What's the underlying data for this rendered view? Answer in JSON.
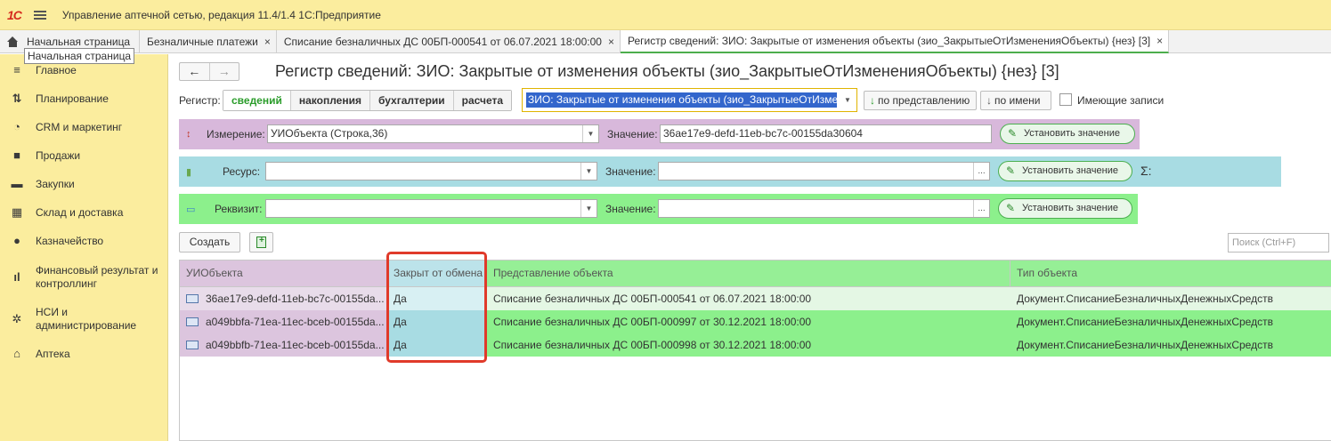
{
  "app": {
    "logo": "1С",
    "title": "Управление аптечной сетью, редакция 11.4/1.4 1С:Предприятие"
  },
  "tabs": [
    {
      "label": "Начальная страница"
    },
    {
      "label": "Безналичные платежи",
      "close": "×"
    },
    {
      "label": "Списание безналичных ДС 00БП-000541 от 06.07.2021 18:00:00",
      "close": "×"
    },
    {
      "label": "Регистр сведений: ЗИО: Закрытые от изменения объекты (зио_ЗакрытыеОтИзмененияОбъекты) {нез} [3]",
      "close": "×"
    }
  ],
  "tooltip": "Начальная страница",
  "sidebar": {
    "items": [
      {
        "label": "Главное",
        "icon": "menu-icon"
      },
      {
        "label": "Планирование",
        "icon": "planning-icon"
      },
      {
        "label": "CRM и маркетинг",
        "icon": "crm-icon"
      },
      {
        "label": "Продажи",
        "icon": "bag-icon"
      },
      {
        "label": "Закупки",
        "icon": "cart-icon"
      },
      {
        "label": "Склад и доставка",
        "icon": "warehouse-icon"
      },
      {
        "label": "Казначейство",
        "icon": "treasury-icon"
      },
      {
        "label": "Финансовый результат и контроллинг",
        "icon": "chart-icon"
      },
      {
        "label": "НСИ и администрирование",
        "icon": "gear-icon"
      },
      {
        "label": "Аптека",
        "icon": "pharmacy-icon"
      }
    ]
  },
  "form": {
    "back": "←",
    "forward": "→",
    "title": "Регистр сведений: ЗИО: Закрытые от изменения объекты (зио_ЗакрытыеОтИзмененияОбъекты) {нез} [3]",
    "register_label": "Регистр:",
    "register_types": [
      "сведений",
      "накопления",
      "бухгалтерии",
      "расчета"
    ],
    "register_value": "ЗИО: Закрытые от изменения объекты (зио_ЗакрытыеОтИзмене",
    "sort_repr": "по представлению",
    "sort_name": "по имени",
    "sort_arrow": "↓",
    "has_records": "Имеющие записи"
  },
  "dimension": {
    "label": "Измерение:",
    "value": "УИОбъекта (Строка,36)",
    "value_label": "Значение:",
    "val": "36ae17e9-defd-11eb-bc7c-00155da30604",
    "button": "Установить значение"
  },
  "resource": {
    "label": "Ресурс:",
    "value": "",
    "value_label": "Значение:",
    "val": "",
    "button": "Установить значение",
    "sigma": "Σ:"
  },
  "requisite": {
    "label": "Реквизит:",
    "value": "",
    "value_label": "Значение:",
    "val": "",
    "button": "Установить значение"
  },
  "toolbar": {
    "create": "Создать",
    "search_placeholder": "Поиск (Ctrl+F)"
  },
  "table": {
    "columns": [
      "УИОбъекта",
      "Закрыт от обмена",
      "Представление объекта",
      "Тип объекта"
    ],
    "rows": [
      [
        "36ae17e9-defd-11eb-bc7c-00155da...",
        "Да",
        "Списание безналичных ДС 00БП-000541 от 06.07.2021 18:00:00",
        "Документ.СписаниеБезналичныхДенежныхСредств"
      ],
      [
        "a049bbfa-71ea-11ec-bceb-00155da...",
        "Да",
        "Списание безналичных ДС 00БП-000997 от 30.12.2021 18:00:00",
        "Документ.СписаниеБезналичныхДенежныхСредств"
      ],
      [
        "a049bbfb-71ea-11ec-bceb-00155da...",
        "Да",
        "Списание безналичных ДС 00БП-000998 от 30.12.2021 18:00:00",
        "Документ.СписаниеБезналичныхДенежныхСредств"
      ]
    ]
  },
  "colors": {
    "accent": "#4cae4c",
    "title_bar": "#fbed9e",
    "highlight": "#e03a2a"
  }
}
